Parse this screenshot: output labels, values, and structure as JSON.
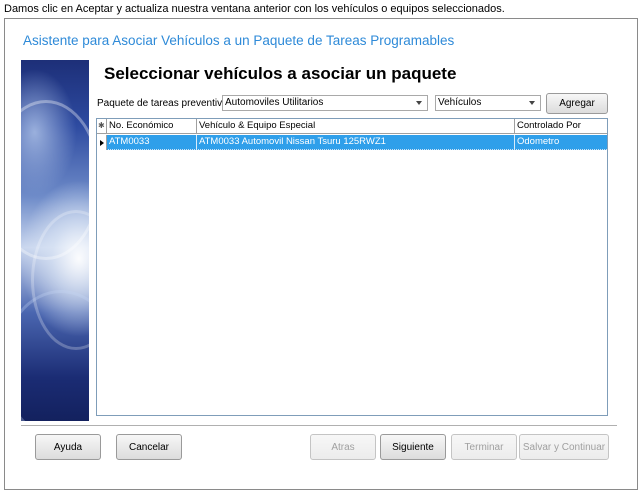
{
  "caption": "Damos clic en Aceptar y actualiza nuestra ventana anterior con los vehículos o equipos seleccionados.",
  "wizard": {
    "title": "Asistente para Asociar Vehículos a un Paquete de Tareas Programables",
    "heading": "Seleccionar vehículos a asociar un paquete"
  },
  "form": {
    "package_label": "Paquete de tareas preventivas:",
    "package_value": "Automoviles Utilitarios",
    "type_value": "Vehículos",
    "add_button": "Agregar"
  },
  "grid": {
    "new_row_marker": "✱",
    "columns": [
      "No. Económico",
      "Vehículo & Equipo Especial",
      "Controlado Por"
    ],
    "rows": [
      {
        "no_economico": "ATM0033",
        "vehiculo": "ATM0033 Automovil  Nissan  Tsuru  125RWZ1",
        "controlado_por": "Odometro",
        "selected": true
      }
    ]
  },
  "buttons": {
    "help": "Ayuda",
    "cancel": "Cancelar",
    "back": "Atras",
    "next": "Siguiente",
    "finish": "Terminar",
    "save_continue": "Salvar y Continuar"
  },
  "colors": {
    "title_blue": "#2e8ad8",
    "selection_blue": "#2f9fea"
  }
}
